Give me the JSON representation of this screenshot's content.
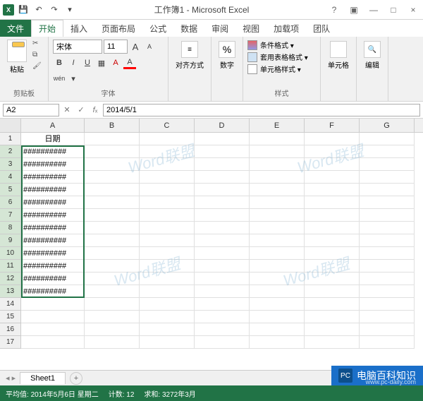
{
  "titlebar": {
    "title": "工作簿1 - Microsoft Excel"
  },
  "window_controls": {
    "help": "?",
    "ribbon_toggle": "▣",
    "min": "—",
    "max": "□",
    "close": "×"
  },
  "tabs": {
    "file": "文件",
    "home": "开始",
    "insert": "插入",
    "layout": "页面布局",
    "formulas": "公式",
    "data": "数据",
    "review": "审阅",
    "view": "视图",
    "addins": "加载项",
    "team": "团队"
  },
  "ribbon": {
    "clipboard": {
      "paste": "粘贴",
      "group": "剪贴板"
    },
    "font": {
      "name": "宋体",
      "size": "11",
      "bold": "B",
      "italic": "I",
      "underline": "U",
      "ruby": "wén",
      "group": "字体",
      "grow": "A",
      "shrink": "A"
    },
    "align": {
      "label": "对齐方式"
    },
    "number": {
      "label": "数字",
      "symbol": "%"
    },
    "styles": {
      "cond": "条件格式 ▾",
      "table": "套用表格格式 ▾",
      "cell": "单元格样式 ▾",
      "group": "样式"
    },
    "cells_grp": {
      "label": "单元格"
    },
    "editing": {
      "label": "编辑"
    }
  },
  "namebox": {
    "ref": "A2"
  },
  "formula_bar": {
    "value": "2014/5/1"
  },
  "columns": [
    "A",
    "B",
    "C",
    "D",
    "E",
    "F",
    "G"
  ],
  "rows": [
    1,
    2,
    3,
    4,
    5,
    6,
    7,
    8,
    9,
    10,
    11,
    12,
    13,
    14,
    15,
    16,
    17
  ],
  "col_a_header": "日期",
  "hash_value": "##########",
  "selected_rows": [
    2,
    3,
    4,
    5,
    6,
    7,
    8,
    9,
    10,
    11,
    12,
    13
  ],
  "sheet_tabs": {
    "sheet1": "Sheet1",
    "add": "+"
  },
  "statusbar": {
    "avg_label": "平均值:",
    "avg": "2014年5月6日 星期二",
    "count_label": "计数:",
    "count": "12",
    "sum_label": "求和:",
    "sum": "3272年3月"
  },
  "watermarks": [
    "Word联盟",
    "Word联盟",
    "Word联盟",
    "Word联盟"
  ],
  "badge": {
    "text": "电脑百科知识",
    "url": "www.pc-daily.com"
  }
}
